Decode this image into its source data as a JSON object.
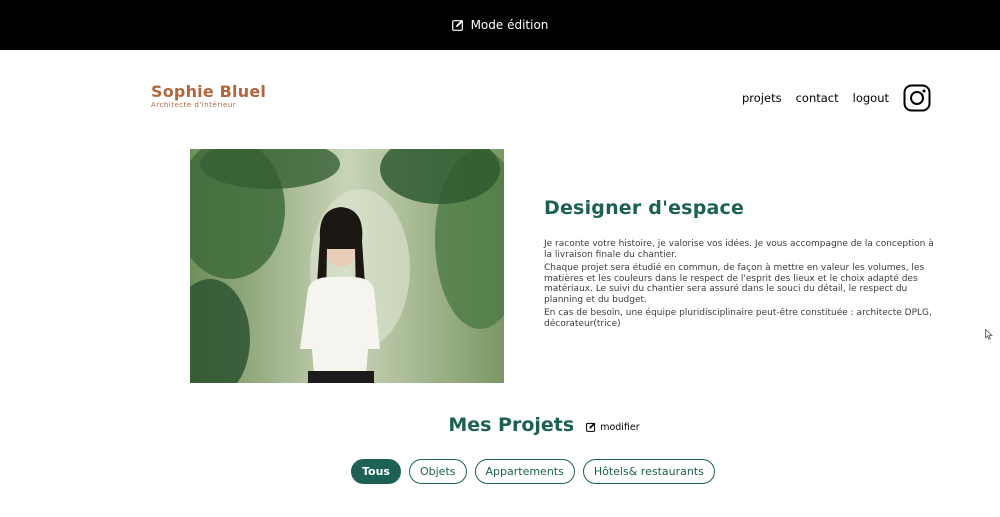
{
  "edit_bar": {
    "label": "Mode édition",
    "icon": "edit-icon"
  },
  "brand": {
    "name": "Sophie Bluel",
    "subtitle": "Architecte d'intérieur"
  },
  "nav": {
    "items": [
      "projets",
      "contact",
      "logout"
    ],
    "instagram_icon": "instagram-icon"
  },
  "intro": {
    "title": "Designer d'espace",
    "paragraphs": [
      "Je raconte votre histoire, je valorise vos idées. Je vous accompagne de la conception à la livraison finale du chantier.",
      "Chaque projet sera étudié en commun, de façon à mettre en valeur les volumes, les matières et les couleurs dans le respect de l'esprit des lieux et le choix adapté des matériaux. Le suivi du chantier sera assuré dans le souci du détail, le respect du planning et du budget.",
      "En cas de besoin, une équipe pluridisciplinaire peut-être constituée : architecte DPLG, décorateur(trice)"
    ]
  },
  "projects": {
    "title": "Mes Projets",
    "modify_label": "modifier",
    "filters": [
      "Tous",
      "Objets",
      "Appartements",
      "Hôtels& restaurants"
    ],
    "active_filter": "Tous"
  },
  "colors": {
    "accent": "#1d6154",
    "brand": "#b1663c",
    "bar": "#000000"
  }
}
